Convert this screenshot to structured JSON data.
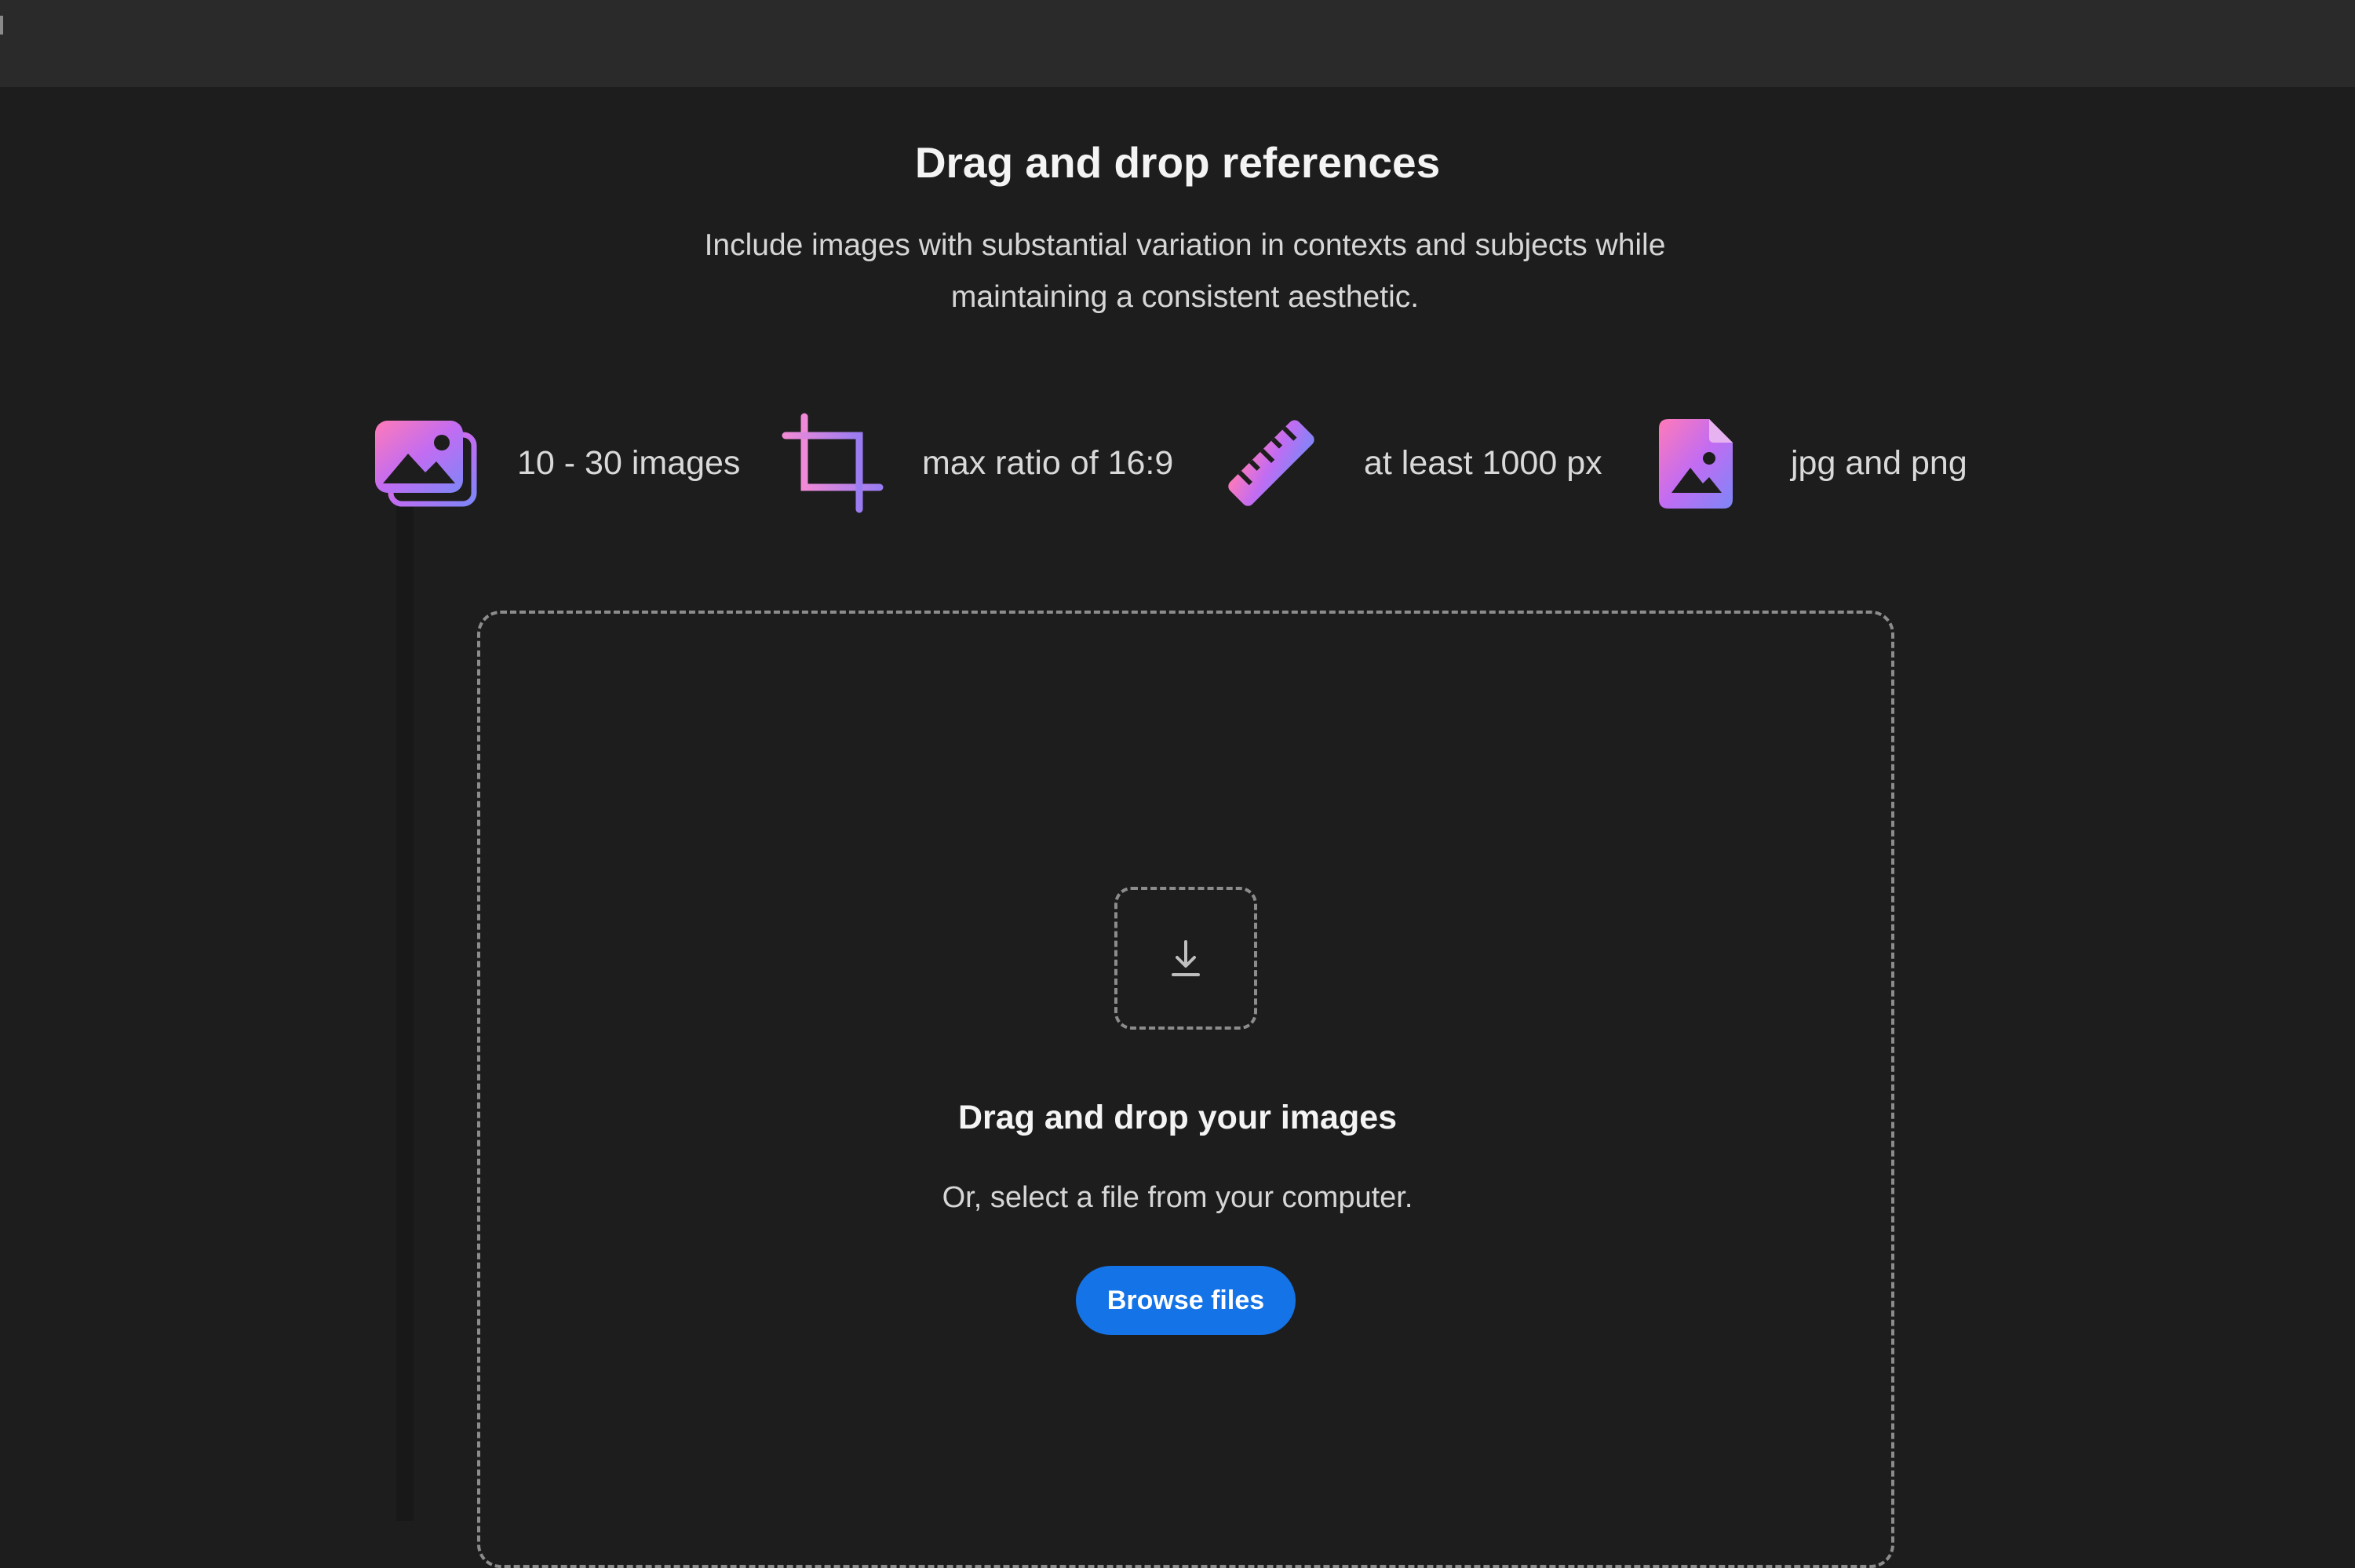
{
  "main": {
    "title": "Drag and drop references",
    "subtitle": "Include images with substantial variation in contexts and subjects while maintaining a consistent aesthetic."
  },
  "requirements": [
    {
      "icon": "images-icon",
      "label": "10 - 30 images"
    },
    {
      "icon": "crop-icon",
      "label": "max ratio of 16:9"
    },
    {
      "icon": "ruler-icon",
      "label": "at least 1000 px"
    },
    {
      "icon": "image-file-icon",
      "label": "jpg and png"
    }
  ],
  "dropzone": {
    "icon": "download-icon",
    "title": "Drag and drop your images",
    "subtitle": "Or, select a file from your computer.",
    "button_label": "Browse files"
  },
  "colors": {
    "background": "#1d1d1d",
    "topbar": "#2a2a2a",
    "accent": "#1473e6",
    "icon_gradient": [
      "#f472c8",
      "#b76cf0",
      "#8a7cf5"
    ]
  }
}
